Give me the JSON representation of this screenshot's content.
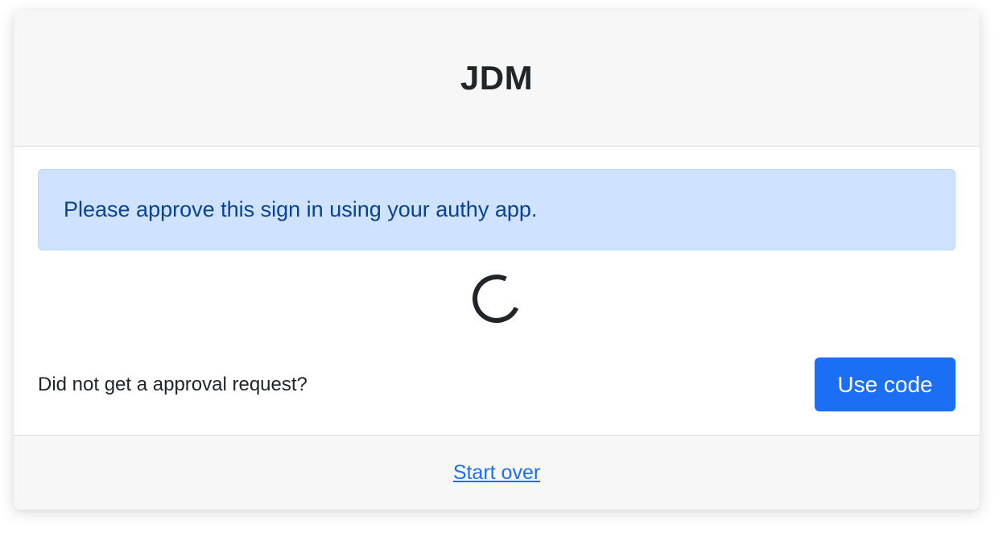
{
  "header": {
    "title": "JDM"
  },
  "alert": {
    "message": "Please approve this sign in using your authy app."
  },
  "spinner": {
    "icon": "loading-spinner-icon"
  },
  "fallback": {
    "prompt": "Did not get a approval request?",
    "button_label": "Use code"
  },
  "footer": {
    "link_label": "Start over"
  },
  "colors": {
    "primary": "#1a6ff5",
    "alert_background": "#cfe2ff",
    "alert_text": "#084298",
    "header_background": "#f7f7f7"
  }
}
